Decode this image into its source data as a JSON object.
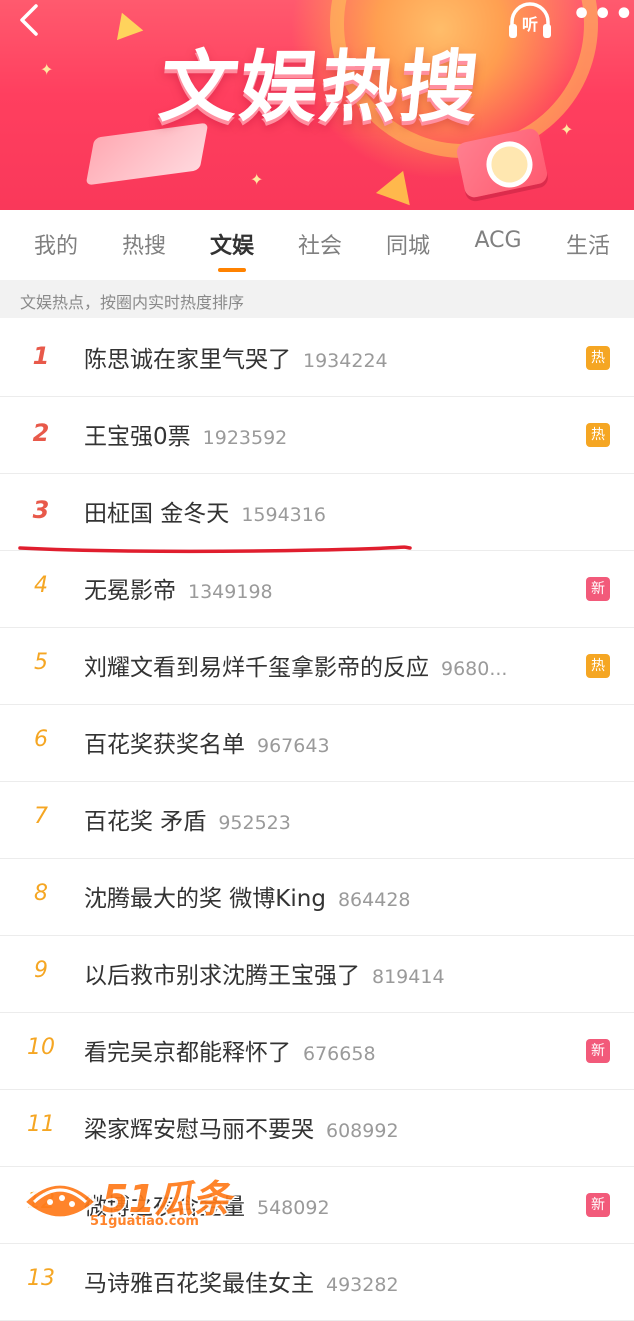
{
  "banner": {
    "title": "文娱热搜",
    "listen_label": "听",
    "more_label": "•••"
  },
  "tabs": [
    {
      "label": "我的",
      "active": false
    },
    {
      "label": "热搜",
      "active": false
    },
    {
      "label": "文娱",
      "active": true
    },
    {
      "label": "社会",
      "active": false
    },
    {
      "label": "同城",
      "active": false
    },
    {
      "label": "ACG",
      "active": false
    },
    {
      "label": "生活",
      "active": false
    }
  ],
  "subtitle": "文娱热点，按圈内实时热度排序",
  "list": [
    {
      "rank": "1",
      "title": "陈思诚在家里气哭了",
      "count": "1934224",
      "badge": "热",
      "badge_type": "hot"
    },
    {
      "rank": "2",
      "title": "王宝强0票",
      "count": "1923592",
      "badge": "热",
      "badge_type": "hot"
    },
    {
      "rank": "3",
      "title": "田柾国 金冬天",
      "count": "1594316",
      "badge": "",
      "badge_type": ""
    },
    {
      "rank": "4",
      "title": "无冕影帝",
      "count": "1349198",
      "badge": "新",
      "badge_type": "new"
    },
    {
      "rank": "5",
      "title": "刘耀文看到易烊千玺拿影帝的反应",
      "count": "9680...",
      "badge": "热",
      "badge_type": "hot"
    },
    {
      "rank": "6",
      "title": "百花奖获奖名单",
      "count": "967643",
      "badge": "",
      "badge_type": ""
    },
    {
      "rank": "7",
      "title": "百花奖 矛盾",
      "count": "952523",
      "badge": "",
      "badge_type": ""
    },
    {
      "rank": "8",
      "title": "沈腾最大的奖 微博King",
      "count": "864428",
      "badge": "",
      "badge_type": ""
    },
    {
      "rank": "9",
      "title": "以后救市别求沈腾王宝强了",
      "count": "819414",
      "badge": "",
      "badge_type": ""
    },
    {
      "rank": "10",
      "title": "看完吴京都能释怀了",
      "count": "676658",
      "badge": "新",
      "badge_type": "new"
    },
    {
      "rank": "11",
      "title": "梁家辉安慰马丽不要哭",
      "count": "608992",
      "badge": "",
      "badge_type": ""
    },
    {
      "rank": "12",
      "title": "微博之夜含金量",
      "count": "548092",
      "badge": "新",
      "badge_type": "new"
    },
    {
      "rank": "13",
      "title": "马诗雅百花奖最佳女主",
      "count": "493282",
      "badge": "",
      "badge_type": ""
    }
  ],
  "watermark": {
    "logo": "51瓜条",
    "url": "51guatiao.com"
  },
  "colors": {
    "accent": "#ff8200",
    "hot_badge": "#f5a623",
    "new_badge": "#f25a7a",
    "top_rank": "#e8594a",
    "annotation": "#e01e2e"
  }
}
